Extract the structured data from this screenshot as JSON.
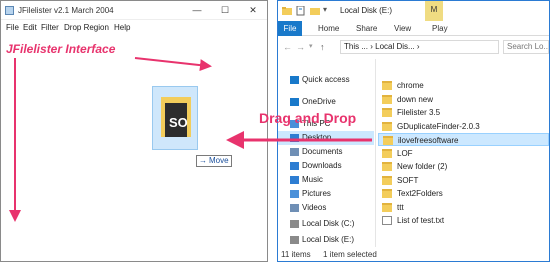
{
  "jfilelister": {
    "title": "JFilelister v2.1 March 2004",
    "window_controls": [
      "—",
      "☐",
      "✕"
    ],
    "menu": [
      "File",
      "Edit",
      "Filter",
      "Drop Region",
      "Help"
    ]
  },
  "annotations": {
    "jfilelister_label": "JFilelister Interface",
    "drag_drop_label": "Drag and Drop",
    "accent_color": "#e8336d"
  },
  "drag": {
    "ghost_text": "SO",
    "tooltip_arrow": "→",
    "tooltip_label": "Move"
  },
  "explorer": {
    "title": "Local Disk (E:)",
    "manage_tab": "M",
    "ribbon_tabs": [
      "File",
      "Home",
      "Share",
      "View",
      "Play"
    ],
    "address": "This ... › Local Dis... ›",
    "search_placeholder": "Search Lo...",
    "nav_items": [
      {
        "label": "Quick access",
        "icon": "star-icon"
      },
      {
        "label": "OneDrive",
        "icon": "cloud-icon"
      },
      {
        "label": "This PC",
        "icon": "computer-icon"
      },
      {
        "label": "Desktop",
        "icon": "desktop-icon"
      },
      {
        "label": "Documents",
        "icon": "documents-icon"
      },
      {
        "label": "Downloads",
        "icon": "downloads-icon"
      },
      {
        "label": "Music",
        "icon": "music-icon"
      },
      {
        "label": "Pictures",
        "icon": "pictures-icon"
      },
      {
        "label": "Videos",
        "icon": "videos-icon"
      },
      {
        "label": "Local Disk (C:)",
        "icon": "drive-icon"
      },
      {
        "label": "Local Disk (E:)",
        "icon": "drive-icon"
      }
    ],
    "files": [
      {
        "name": "chrome",
        "type": "folder"
      },
      {
        "name": "down new",
        "type": "folder"
      },
      {
        "name": "Filelister 3.5",
        "type": "folder"
      },
      {
        "name": "GDuplicateFinder-2.0.3",
        "type": "folder"
      },
      {
        "name": "ilovefreesoftware",
        "type": "folder",
        "selected": true
      },
      {
        "name": "LOF",
        "type": "folder"
      },
      {
        "name": "New folder (2)",
        "type": "folder"
      },
      {
        "name": "SOFT",
        "type": "folder"
      },
      {
        "name": "Text2Folders",
        "type": "folder"
      },
      {
        "name": "ttt",
        "type": "folder"
      },
      {
        "name": "List of test.txt",
        "type": "text"
      }
    ],
    "status": {
      "count": "11 items",
      "selected": "1 item selected"
    }
  }
}
